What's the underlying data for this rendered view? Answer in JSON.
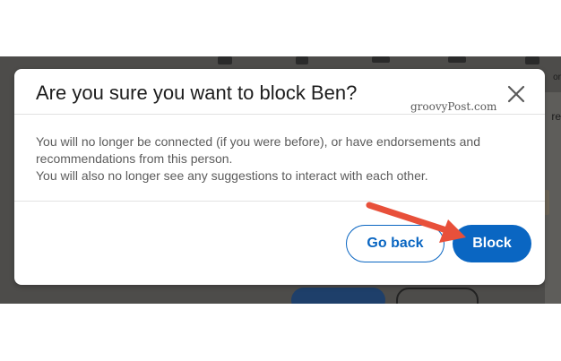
{
  "background": {
    "side_text_top": "or",
    "side_text_mid": "re"
  },
  "dialog": {
    "title": "Are you sure you want to block Ben?",
    "watermark": "groovyPost.com",
    "body_lines": [
      "You will no longer be connected (if you were before), or have endorsements and recommendations from this person.",
      "You will also no longer see any suggestions to interact with each other."
    ],
    "close_icon": "close-icon",
    "buttons": {
      "go_back": "Go back",
      "block": "Block"
    }
  },
  "colors": {
    "accent": "#0a66c2",
    "annotation_arrow": "#e8503a",
    "overlay": "#4d4c4a"
  }
}
